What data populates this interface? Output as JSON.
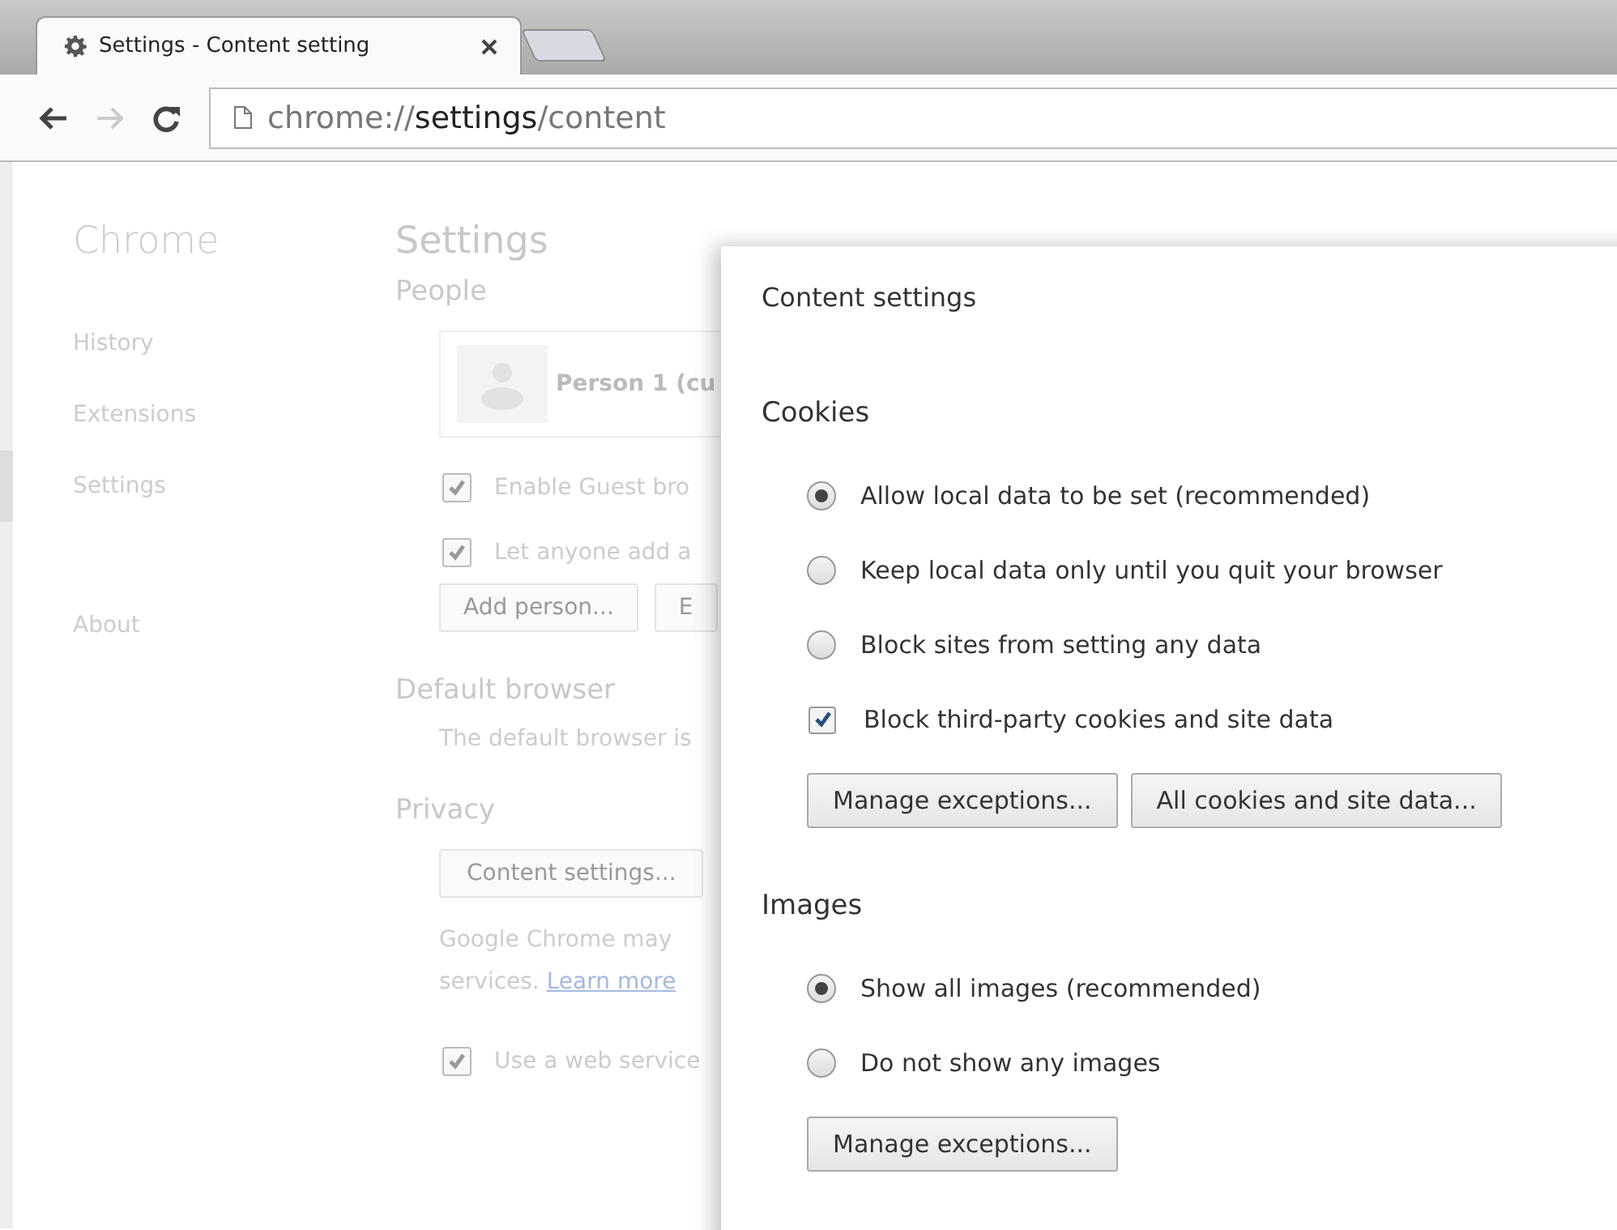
{
  "tabs": [
    {
      "kind": "page",
      "title": "Settings - Content setting",
      "selected": true
    },
    {
      "kind": "new",
      "selected": false
    }
  ],
  "toolbar": {
    "url_prefix": "chrome://",
    "url_host": "settings",
    "url_path": "/content",
    "back_enabled": true,
    "forward_enabled": false
  },
  "sidebar": {
    "title": "Chrome",
    "items": [
      {
        "label": "History",
        "selected": false
      },
      {
        "label": "Extensions",
        "selected": false
      },
      {
        "label": "Settings",
        "selected": true
      },
      {
        "label": "About",
        "selected": false
      }
    ]
  },
  "settings_page": {
    "title": "Settings",
    "people": {
      "heading": "People",
      "profile_name": "Person 1 (cu",
      "options": [
        {
          "label": "Enable Guest bro",
          "checked": true
        },
        {
          "label": "Let anyone add a",
          "checked": true
        }
      ],
      "buttons": [
        "Add person...",
        "E"
      ]
    },
    "default_browser": {
      "heading": "Default browser",
      "text": "The default browser is"
    },
    "privacy": {
      "heading": "Privacy",
      "button": "Content settings...",
      "text_line_1": "Google Chrome may",
      "text_line_2": "services.",
      "link": "Learn more",
      "option": {
        "label": "Use a web service",
        "checked": true
      }
    }
  },
  "dialog": {
    "title": "Content settings",
    "sections": [
      {
        "heading": "Cookies",
        "options": [
          {
            "kind": "radio",
            "label": "Allow local data to be set (recommended)",
            "selected": true
          },
          {
            "kind": "radio",
            "label": "Keep local data only until you quit your browser",
            "selected": false
          },
          {
            "kind": "radio",
            "label": "Block sites from setting any data",
            "selected": false
          },
          {
            "kind": "checkbox",
            "label": "Block third-party cookies and site data",
            "checked": true
          }
        ],
        "buttons": [
          "Manage exceptions...",
          "All cookies and site data..."
        ]
      },
      {
        "heading": "Images",
        "options": [
          {
            "kind": "radio",
            "label": "Show all images (recommended)",
            "selected": true
          },
          {
            "kind": "radio",
            "label": "Do not show any images",
            "selected": false
          }
        ],
        "buttons": [
          "Manage exceptions..."
        ]
      }
    ]
  }
}
